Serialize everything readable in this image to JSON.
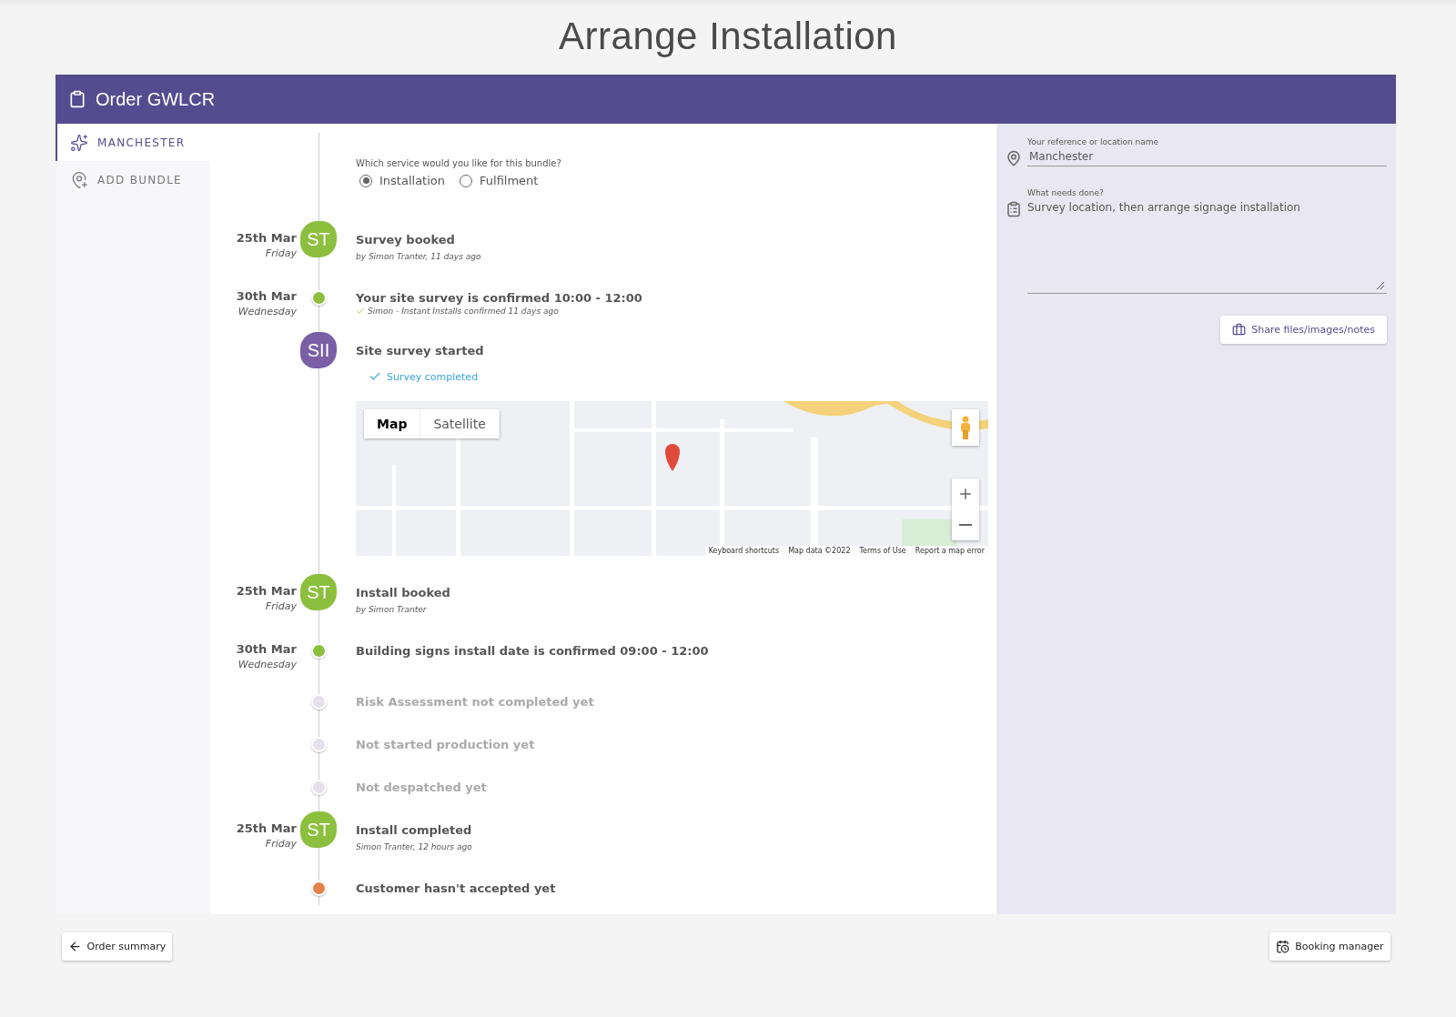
{
  "page_title": "Arrange Installation",
  "order": {
    "title": "Order GWLCR"
  },
  "sidebar": {
    "items": [
      {
        "label": "MANCHESTER",
        "selected": true
      },
      {
        "label": "ADD BUNDLE",
        "selected": false
      }
    ]
  },
  "service": {
    "question": "Which service would you like for this bundle?",
    "options": [
      {
        "label": "Installation",
        "selected": true
      },
      {
        "label": "Fulfilment",
        "selected": false
      }
    ]
  },
  "timeline": [
    {
      "date": "25th Mar",
      "day": "Friday",
      "marker": {
        "kind": "avatar",
        "initials": "ST",
        "color": "#8dbf3f"
      },
      "title": "Survey booked",
      "muted": false,
      "detail": {
        "kind": "byline",
        "text": "by Simon Tranter, 11 days ago"
      }
    },
    {
      "date": "30th Mar",
      "day": "Wednesday",
      "marker": {
        "kind": "dot",
        "color": "#8dbf3f"
      },
      "title": "Your site survey is confirmed 10:00 - 12:00",
      "muted": false,
      "detail": {
        "kind": "confirmed",
        "text": "Simon - Instant Installs confirmed 11 days ago"
      }
    },
    {
      "marker": {
        "kind": "avatar",
        "initials": "SII",
        "color": "#7a5fa6"
      },
      "title": "Site survey started",
      "muted": false,
      "detail": {
        "kind": "completed",
        "text": "Survey completed"
      },
      "map": {
        "type_options": [
          {
            "label": "Map",
            "selected": true
          },
          {
            "label": "Satellite",
            "selected": false
          }
        ],
        "footer": [
          "Keyboard shortcuts",
          "Map data ©2022",
          "Terms of Use",
          "Report a map error"
        ]
      }
    },
    {
      "date": "25th Mar",
      "day": "Friday",
      "marker": {
        "kind": "avatar",
        "initials": "ST",
        "color": "#8dbf3f"
      },
      "title": "Install booked",
      "muted": false,
      "detail": {
        "kind": "byline",
        "text": "by Simon Tranter"
      }
    },
    {
      "date": "30th Mar",
      "day": "Wednesday",
      "marker": {
        "kind": "dot",
        "color": "#8dbf3f"
      },
      "title": "Building signs install date is confirmed 09:00 - 12:00",
      "muted": false
    },
    {
      "marker": {
        "kind": "dot",
        "color": "#e6e0ec"
      },
      "title": "Risk Assessment not completed yet",
      "muted": true
    },
    {
      "marker": {
        "kind": "dot",
        "color": "#e6e0ec"
      },
      "title": "Not started production yet",
      "muted": true
    },
    {
      "marker": {
        "kind": "dot",
        "color": "#e6e0ec"
      },
      "title": "Not despatched yet",
      "muted": true
    },
    {
      "date": "25th Mar",
      "day": "Friday",
      "marker": {
        "kind": "avatar",
        "initials": "ST",
        "color": "#8dbf3f"
      },
      "title": "Install completed",
      "muted": false,
      "detail": {
        "kind": "byline",
        "text": "Simon Tranter, 12 hours ago"
      }
    },
    {
      "marker": {
        "kind": "dot",
        "color": "#e5824b"
      },
      "title": "Customer hasn't accepted yet",
      "muted": false
    }
  ],
  "details": {
    "reference": {
      "label": "Your reference or location name",
      "value": "Manchester"
    },
    "needs": {
      "label": "What needs done?",
      "value": "Survey location, then arrange signage installation"
    },
    "share_button": "Share files/images/notes"
  },
  "footer": {
    "back_button": "Order summary",
    "booking_button": "Booking manager"
  }
}
